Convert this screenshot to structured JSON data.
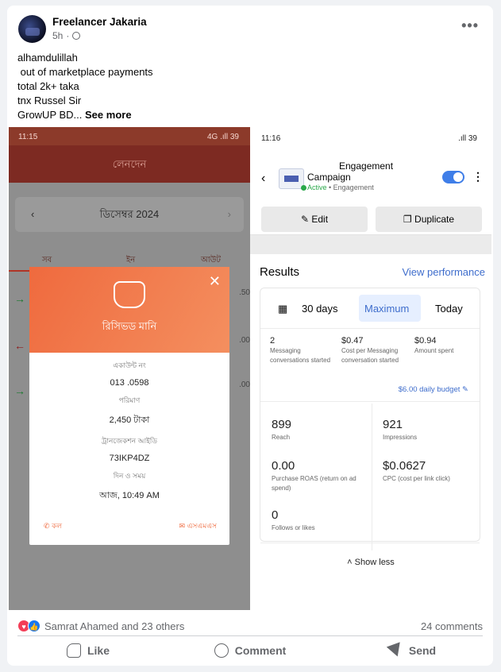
{
  "post": {
    "author": "Freelancer Jakaria",
    "time": "5h",
    "privacy_icon": "globe-icon",
    "lines": [
      "alhamdulillah",
      " out of marketplace payments",
      "total 2k+ taka",
      "tnx Russel Sir"
    ],
    "last_line": "GrowUP BD...",
    "see_more": "See more"
  },
  "left_shot": {
    "status_time": "11:15",
    "status_right": "4G .ıll 39",
    "title": "লেনদেন",
    "month": "ডিসেম্বর 2024",
    "tabs": [
      "সব",
      "ইন",
      "আউট"
    ],
    "amounts": [
      ".50",
      ".00",
      ".00"
    ],
    "modal": {
      "title": "রিসিভড মানি",
      "account_label": "একাউন্ট নং",
      "account_value": "013​     .0598",
      "amount_label": "পরিমাণ",
      "amount_value": "2,450 টাকা",
      "trx_label": "ট্রানজেকশন আইডি",
      "trx_value": "73IKP4DZ",
      "datetime_label": "দিন ও সময়",
      "datetime_value": "আজ, 10:49 AM",
      "call": "কল",
      "sms": "এসএমএস"
    }
  },
  "right_shot": {
    "status_time": "11:16",
    "status_right": ".ıll 39",
    "engagement": "Engagement",
    "campaign": "Campaign",
    "active": "Active",
    "active_sub": " • Engagement",
    "edit": "Edit",
    "duplicate": "Duplicate",
    "results_title": "Results",
    "view_performance": "View performance",
    "segments": [
      "30 days",
      "Maximum",
      "Today"
    ],
    "metrics": [
      {
        "value": "2",
        "label": "Messaging conversations started"
      },
      {
        "value": "$0.47",
        "label": "Cost per Messaging conversation started"
      },
      {
        "value": "$0.94",
        "label": "Amount spent"
      }
    ],
    "budget": "$6.00 daily budget",
    "kpis": [
      {
        "value": "899",
        "label": "Reach"
      },
      {
        "value": "921",
        "label": "Impressions"
      },
      {
        "value": "0.00",
        "label": "Purchase ROAS (return on ad spend)"
      },
      {
        "value": "$0.0627",
        "label": "CPC (cost per link click)"
      },
      {
        "value": "0",
        "label": "Follows or likes"
      }
    ],
    "show_less": "Show less"
  },
  "stats": {
    "reactions_text": "Samrat Ahamed and 23 others",
    "comments": "24 comments"
  },
  "actions": {
    "like": "Like",
    "comment": "Comment",
    "send": "Send"
  }
}
